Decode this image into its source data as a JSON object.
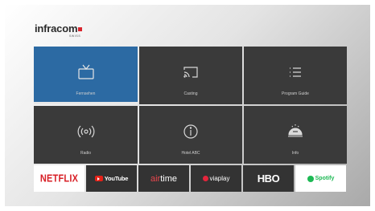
{
  "brand": {
    "name": "infracom",
    "sub": "SWISS",
    "accent": "#d9262e"
  },
  "tiles": [
    {
      "label": "Fernsehen",
      "icon": "tv-icon",
      "active": true
    },
    {
      "label": "Casting",
      "icon": "cast-icon",
      "active": false
    },
    {
      "label": "Program Guide",
      "icon": "list-icon",
      "active": false
    },
    {
      "label": "Radio",
      "icon": "radio-icon",
      "active": false
    },
    {
      "label": "Hotel ABC",
      "icon": "info-circle-icon",
      "active": false
    },
    {
      "label": "Info",
      "icon": "hotel-icon",
      "active": false
    }
  ],
  "apps": {
    "netflix": "NETFLIX",
    "youtube": "YouTube",
    "airtime_a": "air",
    "airtime_b": "time",
    "viaplay": "viaplay",
    "hbo": "HBO",
    "spotify": "Spotify"
  },
  "colors": {
    "active_tile": "#2c6aa3",
    "tile": "#3a3a3a"
  }
}
